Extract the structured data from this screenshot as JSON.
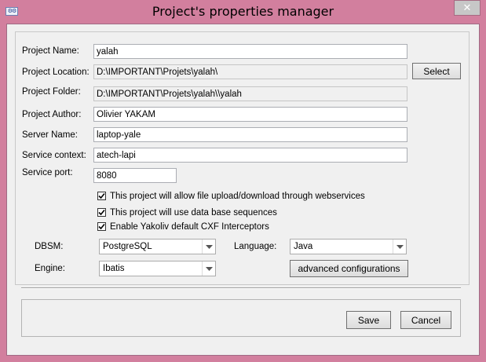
{
  "window": {
    "title": "Project's properties manager",
    "close_glyph": "✕",
    "icon": "gear-icon"
  },
  "form": {
    "project_name": {
      "label": "Project Name:",
      "value": "yalah"
    },
    "project_location": {
      "label": "Project Location:",
      "value": "D:\\IMPORTANT\\Projets\\yalah\\"
    },
    "project_folder": {
      "label": "Project Folder:",
      "value": "D:\\IMPORTANT\\Projets\\yalah\\\\yalah"
    },
    "project_author": {
      "label": "Project Author:",
      "value": "Olivier YAKAM"
    },
    "server_name": {
      "label": "Server Name:",
      "value": "laptop-yale"
    },
    "service_context": {
      "label": "Service context:",
      "value": "atech-lapi"
    },
    "service_port": {
      "label": "Service port:",
      "value": "8080"
    }
  },
  "select_button": "Select",
  "checkboxes": [
    {
      "label": "This project will allow file upload/download through webservices",
      "checked": true
    },
    {
      "label": "This project will use data base sequences",
      "checked": true
    },
    {
      "label": "Enable Yakoliv default CXF Interceptors",
      "checked": true
    }
  ],
  "dbsm": {
    "label": "DBSM:",
    "value": "PostgreSQL"
  },
  "language": {
    "label": "Language:",
    "value": "Java"
  },
  "engine": {
    "label": "Engine:",
    "value": "Ibatis"
  },
  "advanced_button": "advanced configurations",
  "save_button": "Save",
  "cancel_button": "Cancel"
}
